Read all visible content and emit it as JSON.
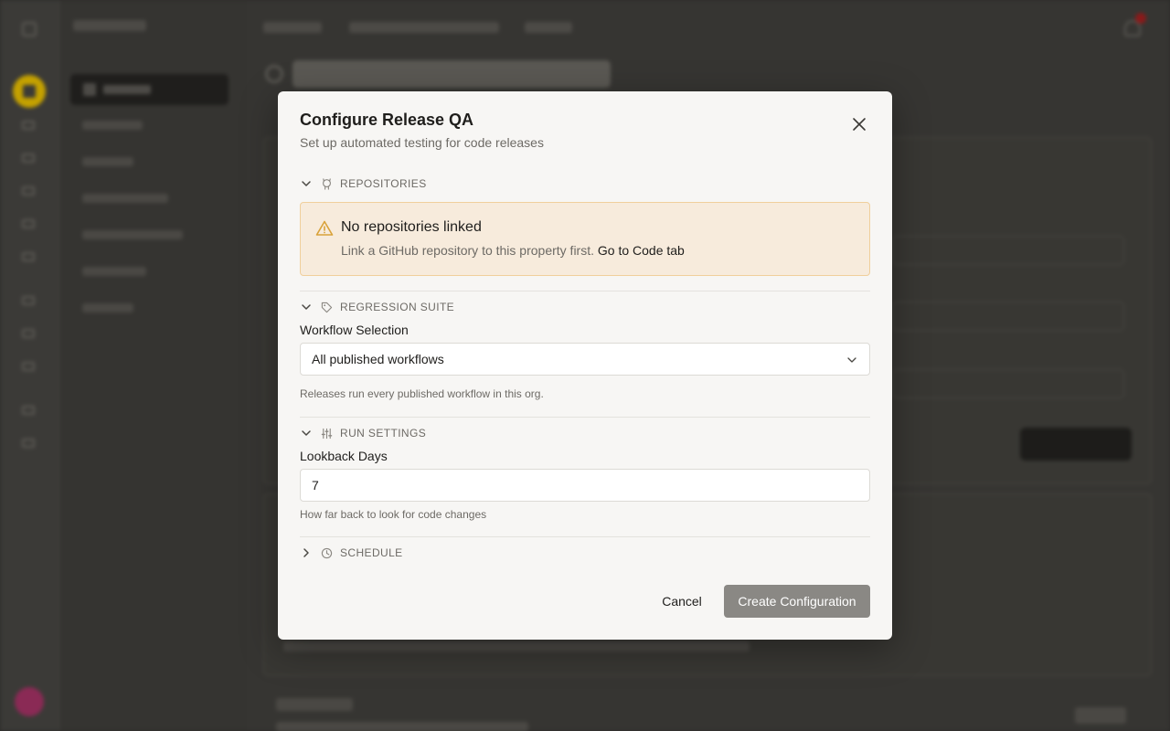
{
  "modal": {
    "title": "Configure Release QA",
    "subtitle": "Set up automated testing for code releases",
    "sections": {
      "repositories": {
        "label": "REPOSITORIES",
        "expanded": true,
        "warning": {
          "title": "No repositories linked",
          "text": "Link a GitHub repository to this property first.",
          "link": "Go to Code tab"
        }
      },
      "regression": {
        "label": "REGRESSION SUITE",
        "expanded": true,
        "field_label": "Workflow Selection",
        "selected": "All published workflows",
        "help": "Releases run every published workflow in this org."
      },
      "run_settings": {
        "label": "RUN SETTINGS",
        "expanded": true,
        "field_label": "Lookback Days",
        "value": "7",
        "help": "How far back to look for code changes"
      },
      "schedule": {
        "label": "SCHEDULE",
        "expanded": false
      }
    },
    "cancel_label": "Cancel",
    "create_label": "Create Configuration"
  },
  "colors": {
    "overlay": "#2c2b29",
    "modal_bg": "#f7f6f4",
    "warning_bg": "#f7ebdc",
    "warning_border": "#f0cf9c",
    "warning_icon": "#d9a23a",
    "primary_disabled": "#8a8884",
    "rail_logo": "#c4a100"
  },
  "icons": {
    "close": "close-icon",
    "repositories": "github-icon",
    "regression": "tag-icon",
    "run_settings": "sliders-icon",
    "schedule": "clock-icon",
    "warning": "warning-triangle-icon"
  }
}
